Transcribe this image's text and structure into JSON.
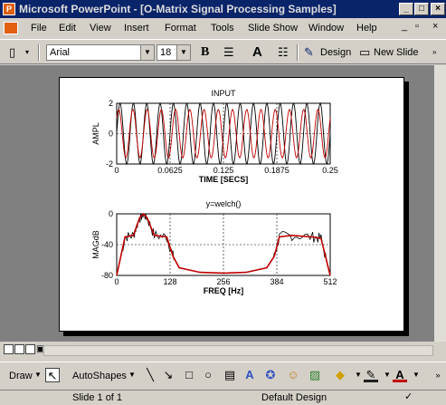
{
  "window": {
    "title": "Microsoft PowerPoint - [O-Matrix Signal Processing Samples]",
    "app_icon": "powerpoint-icon",
    "title_color": "#0a246a"
  },
  "menu": [
    "File",
    "Edit",
    "View",
    "Insert",
    "Format",
    "Tools",
    "Slide Show",
    "Window",
    "Help"
  ],
  "toolbar": {
    "font_name": "Arial",
    "font_size": "18",
    "bold_label": "B",
    "design_label": "Design",
    "new_slide_label": "New Slide"
  },
  "drawing_toolbar": {
    "draw_label": "Draw",
    "autoshapes_label": "AutoShapes"
  },
  "status": {
    "slide_info": "Slide 1 of 1",
    "design": "Default Design"
  },
  "slide": {
    "chart_data": [
      {
        "type": "line",
        "title": "INPUT",
        "xlabel": "TIME [SECS]",
        "ylabel": "AMPL",
        "xlim": [
          0,
          0.25
        ],
        "ylim": [
          -2,
          2
        ],
        "x_ticks": [
          "0",
          "0.0625",
          "0.125",
          "0.1875",
          "0.25"
        ],
        "y_ticks": [
          "2",
          "0",
          "-2"
        ],
        "grid": true,
        "series": [
          {
            "color": "#000000",
            "freq_hz": 64,
            "amplitude": 2
          },
          {
            "color": "#c00000",
            "freq_hz": 60,
            "amplitude": 1.6
          }
        ]
      },
      {
        "type": "line",
        "title": "y=welch()",
        "xlabel": "FREQ [Hz]",
        "ylabel": "MAGdB",
        "xlim": [
          0,
          512
        ],
        "ylim": [
          -80,
          0
        ],
        "x_ticks": [
          "0",
          "128",
          "256",
          "384",
          "512"
        ],
        "y_ticks": [
          "0",
          "-40",
          "-80"
        ],
        "grid": true,
        "series": [
          {
            "color": "#c00000",
            "x": [
              0,
              20,
              40,
              55,
              64,
              73,
              90,
              120,
              135,
              150,
              200,
              256,
              310,
              360,
              378,
              390,
              420,
              470,
              490,
              512
            ],
            "y": [
              -80,
              -30,
              -28,
              -5,
              0,
              -5,
              -28,
              -30,
              -55,
              -70,
              -76,
              -77,
              -76,
              -70,
              -55,
              -30,
              -28,
              -30,
              -32,
              -80
            ]
          }
        ]
      }
    ]
  }
}
